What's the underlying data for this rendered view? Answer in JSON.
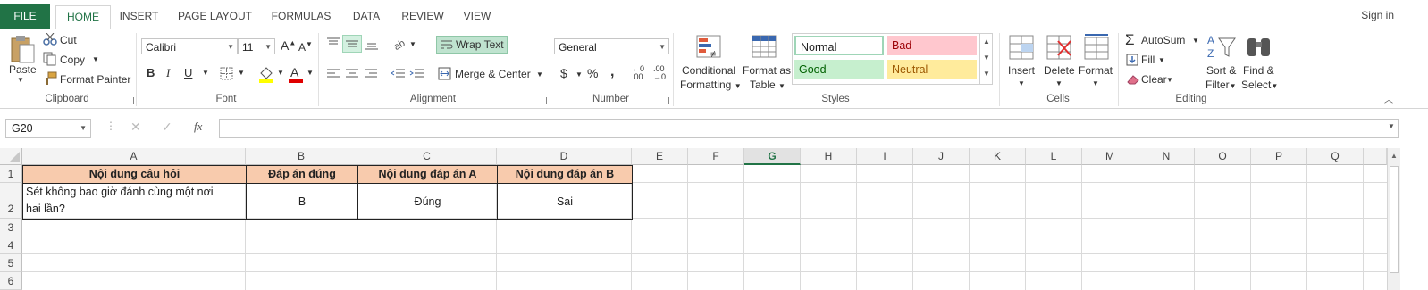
{
  "tabs": {
    "file": "FILE",
    "home": "HOME",
    "insert": "INSERT",
    "page_layout": "PAGE LAYOUT",
    "formulas": "FORMULAS",
    "data": "DATA",
    "review": "REVIEW",
    "view": "VIEW"
  },
  "signin": "Sign in",
  "clipboard": {
    "paste": "Paste",
    "cut": "Cut",
    "copy": "Copy",
    "format_painter": "Format Painter",
    "label": "Clipboard"
  },
  "font": {
    "name": "Calibri",
    "size": "11",
    "bold": "B",
    "italic": "I",
    "underline": "U",
    "label": "Font"
  },
  "alignment": {
    "wrap_text": "Wrap Text",
    "merge_center": "Merge & Center",
    "label": "Alignment"
  },
  "number": {
    "format": "General",
    "currency": "$",
    "percent": "%",
    "comma": ",",
    "label": "Number"
  },
  "styles": {
    "conditional_1": "Conditional",
    "conditional_2": "Formatting",
    "format_table_1": "Format as",
    "format_table_2": "Table",
    "normal": "Normal",
    "bad": "Bad",
    "good": "Good",
    "neutral": "Neutral",
    "label": "Styles"
  },
  "cells": {
    "insert": "Insert",
    "delete": "Delete",
    "format": "Format",
    "label": "Cells"
  },
  "editing": {
    "autosum": "AutoSum",
    "fill": "Fill",
    "clear": "Clear",
    "sort_1": "Sort &",
    "sort_2": "Filter",
    "find_1": "Find &",
    "find_2": "Select",
    "label": "Editing"
  },
  "formula_bar": {
    "name_box": "G20",
    "fx": "fx",
    "value": ""
  },
  "columns": [
    "A",
    "B",
    "C",
    "D",
    "E",
    "F",
    "G",
    "H",
    "I",
    "J",
    "K",
    "L",
    "M",
    "N",
    "O",
    "P",
    "Q"
  ],
  "rows": [
    "1",
    "2",
    "3",
    "4",
    "5",
    "6"
  ],
  "sheet": {
    "a1": "Nội dung câu hỏi",
    "b1": "Đáp án đúng",
    "c1": "Nội dung đáp án A",
    "d1": "Nội dung đáp án B",
    "a2_line1": "Sét không bao giờ đánh cùng một nơi",
    "a2_line2": "hai lần?",
    "b2": "B",
    "c2": "Đúng",
    "d2": "Sai"
  },
  "colors": {
    "accent": "#217346",
    "header_fill": "#f8cbad",
    "bad_fill": "#ffc7ce",
    "good_fill": "#c6efce",
    "neutral_fill": "#ffeb9c"
  }
}
